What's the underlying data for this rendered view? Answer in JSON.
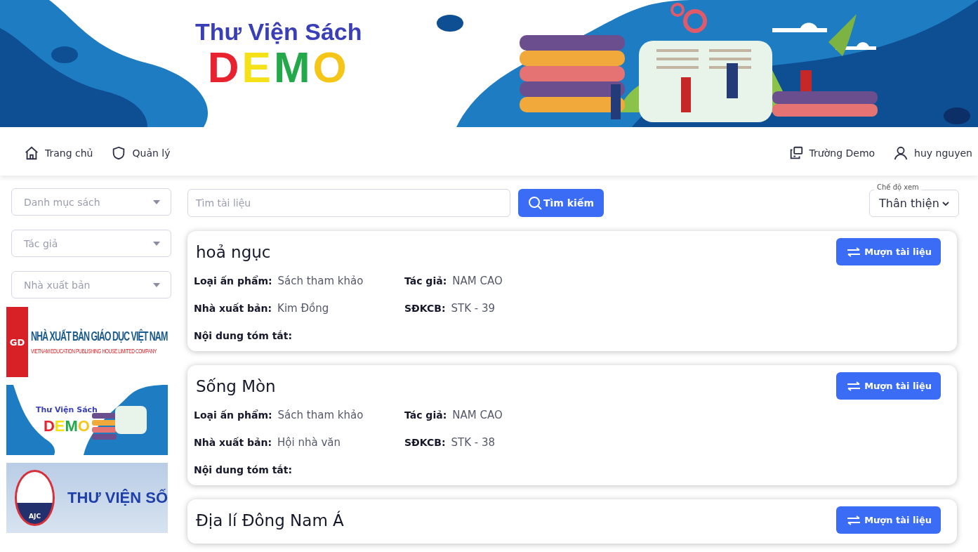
{
  "banner": {
    "title": "Thư Viện Sách",
    "subtitle": "DEMO"
  },
  "nav": {
    "left": [
      {
        "label": "Trang chủ"
      },
      {
        "label": "Quản lý"
      }
    ],
    "right": [
      {
        "label": "Trường Demo"
      },
      {
        "label": "huy nguyen"
      }
    ]
  },
  "filters": [
    {
      "placeholder": "Danh mục sách"
    },
    {
      "placeholder": "Tác giả"
    },
    {
      "placeholder": "Nhà xuất bản"
    }
  ],
  "logos": [
    {
      "kind": "publisher",
      "lines": [
        "NHÀ XUẤT BẢN GIÁO DỤC VIỆT NAM",
        "VIETNAM EDUCATION PUBLISHING HOUSE LIMITED COMPANY"
      ],
      "mark": "GD"
    },
    {
      "kind": "demo",
      "lines": [
        "Thư Viện Sách",
        "DEMO"
      ]
    },
    {
      "kind": "digital",
      "lines": [
        "THƯ VIỆN SỐ"
      ],
      "mark": "AJC"
    }
  ],
  "search": {
    "placeholder": "Tìm tài liệu",
    "button": "Tìm kiếm"
  },
  "view_mode": {
    "label": "Chế độ xem",
    "value": "Thân thiện"
  },
  "books": [
    {
      "title": "hoả ngục",
      "button": "Mượn tài liệu",
      "fields": [
        {
          "label": "Loại ấn phẩm:",
          "value": "Sách tham khảo"
        },
        {
          "label": "Tác giả:",
          "value": "NAM CAO"
        },
        {
          "label": "Nhà xuất bản:",
          "value": "Kim Đồng"
        },
        {
          "label": "SĐKCB:",
          "value": "STK - 39"
        }
      ],
      "summary_label": "Nội dung tóm tắt:"
    },
    {
      "title": "Sống Mòn",
      "button": "Mượn tài liệu",
      "fields": [
        {
          "label": "Loại ấn phẩm:",
          "value": "Sách tham khảo"
        },
        {
          "label": "Tác giả:",
          "value": "NAM CAO"
        },
        {
          "label": "Nhà xuất bản:",
          "value": "Hội nhà văn"
        },
        {
          "label": "SĐKCB:",
          "value": "STK - 38"
        }
      ],
      "summary_label": "Nội dung tóm tắt:"
    },
    {
      "title": "Địa lí Đông Nam Á",
      "button": "Mượn tài liệu"
    }
  ]
}
